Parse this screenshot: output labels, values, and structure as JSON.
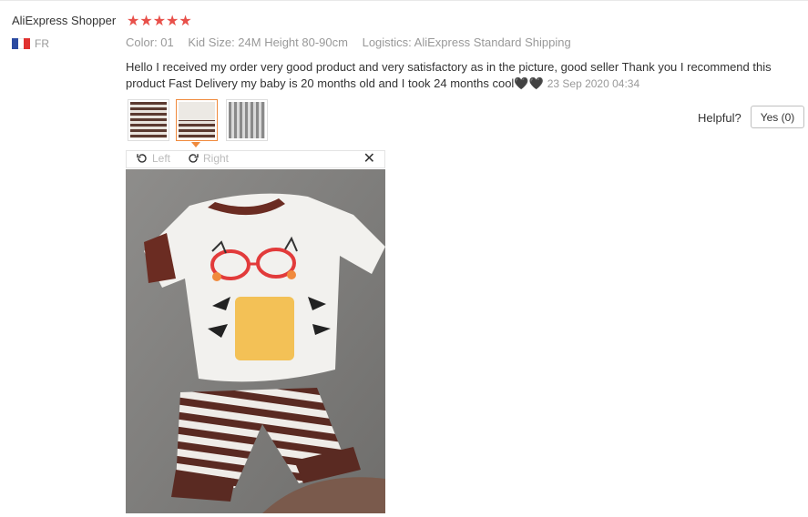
{
  "review": {
    "username": "AliExpress Shopper",
    "stars": "★★★★★",
    "rating": 5,
    "country": "FR",
    "flag_colors": [
      "#2b4aa1",
      "#ffffff",
      "#e0312f"
    ],
    "attributes": {
      "color": "Color: 01",
      "size": "Kid Size: 24M Height 80-90cm",
      "logistics": "Logistics: AliExpress Standard Shipping"
    },
    "text": "Hello I received my order very good product and very satisfactory as in the picture, good seller Thank you I recommend this product Fast Delivery my baby is 20 months old and I took 24 months cool🖤🖤",
    "date": "23 Sep 2020 04:34",
    "thumbnails": [
      {
        "icon": "photo-thumbnail-1"
      },
      {
        "icon": "photo-thumbnail-2",
        "active": true
      },
      {
        "icon": "photo-thumbnail-3"
      }
    ],
    "viewer": {
      "rotate_left_label": "Left",
      "rotate_right_label": "Right",
      "close_label": "✕"
    },
    "helpful_label": "Helpful?",
    "yes_button_label": "Yes (0)"
  },
  "colors": {
    "star": "#e8504a",
    "accent": "#f08a3c",
    "muted_text": "#999999"
  }
}
